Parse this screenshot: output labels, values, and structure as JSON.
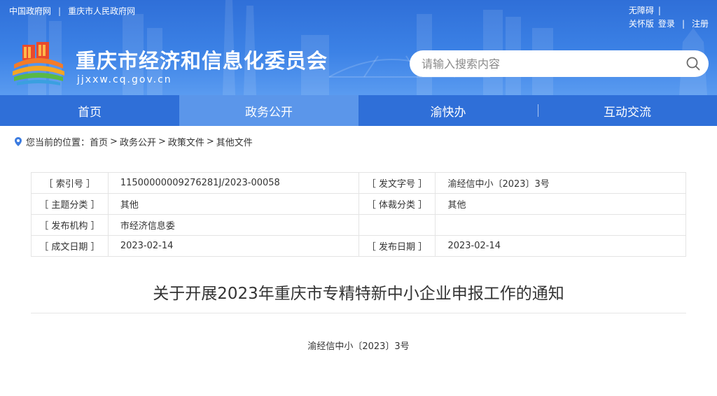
{
  "top_links": [
    "中国政府网",
    "重庆市人民政府网"
  ],
  "top_right": {
    "accessibility": "无障碍",
    "elder_mode": "关怀版",
    "login": "登录",
    "register": "注册"
  },
  "site": {
    "title": "重庆市经济和信息化委员会",
    "domain": "jjxxw.cq.gov.cn"
  },
  "search": {
    "placeholder": "请输入搜索内容",
    "icon": "search-icon"
  },
  "nav": {
    "items": [
      "首页",
      "政务公开",
      "渝快办",
      "互动交流"
    ],
    "active_index": 1
  },
  "breadcrumb": {
    "prefix": "您当前的位置：",
    "crumbs": [
      "首页",
      "政务公开",
      "政策文件",
      "其他文件"
    ],
    "separator": ">"
  },
  "meta": {
    "index_no_label": "［ 索引号 ］",
    "index_no": "11500000009276281J/2023-00058",
    "doc_no_label": "［ 发文字号 ］",
    "doc_no": "渝经信中小〔2023〕3号",
    "topic_label": "［ 主题分类 ］",
    "topic": "其他",
    "genre_label": "［ 体裁分类 ］",
    "genre": "其他",
    "issuer_label": "［ 发布机构 ］",
    "issuer": "市经济信息委",
    "written_date_label": "［ 成文日期 ］",
    "written_date": "2023-02-14",
    "publish_date_label": "［ 发布日期 ］",
    "publish_date": "2023-02-14"
  },
  "document": {
    "title": "关于开展2023年重庆市专精特新中小企业申报工作的通知",
    "number": "渝经信中小〔2023〕3号"
  },
  "colors": {
    "header_blue": "#2f6fd8",
    "nav_active": "#5b96ea",
    "pin_blue": "#3b7be0"
  }
}
